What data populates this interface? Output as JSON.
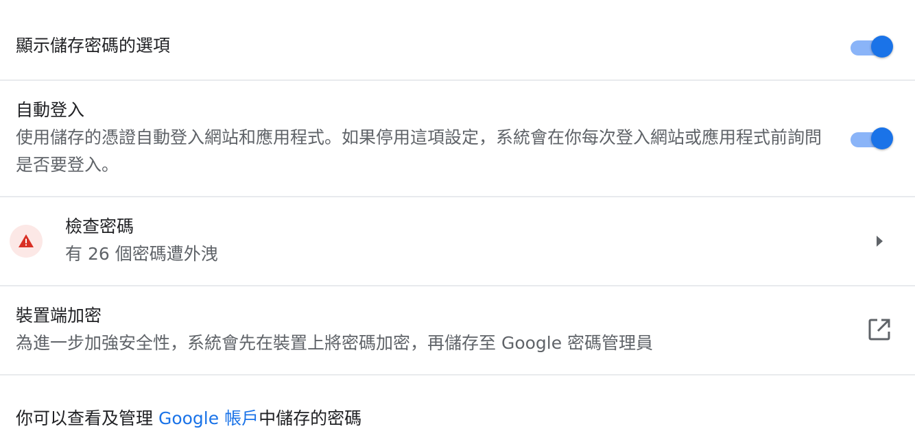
{
  "save_passwords": {
    "title": "顯示儲存密碼的選項",
    "toggle_on": true
  },
  "auto_sign_in": {
    "title": "自動登入",
    "description": "使用儲存的憑證自動登入網站和應用程式。如果停用這項設定，系統會在你每次登入網站或應用程式前詢問是否要登入。",
    "toggle_on": true
  },
  "password_check": {
    "title": "檢查密碼",
    "description": "有 26 個密碼遭外洩",
    "icon": "warning-icon",
    "action_icon": "chevron-right-icon"
  },
  "on_device_encryption": {
    "title": "裝置端加密",
    "description": "為進一步加強安全性，系統會先在裝置上將密碼加密，再儲存至 Google 密碼管理員",
    "action_icon": "open-in-new-icon"
  },
  "google_account": {
    "text_before": "你可以查看及管理",
    "link_text": "Google 帳戶",
    "text_after": "中儲存的密碼"
  },
  "colors": {
    "accent": "#1a73e8",
    "toggle_track": "#8ab4f8",
    "warning": "#d93025",
    "warning_bg": "#fce8e6",
    "divider": "#e8eaed"
  }
}
